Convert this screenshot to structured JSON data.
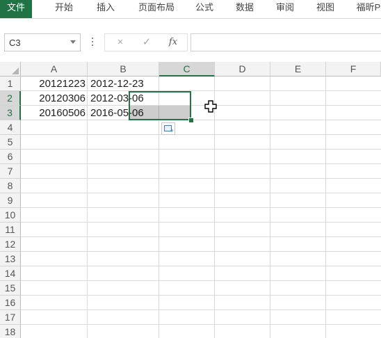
{
  "ribbon": {
    "tabs": [
      "文件",
      "开始",
      "插入",
      "页面布局",
      "公式",
      "数据",
      "审阅",
      "视图",
      "福昕P"
    ],
    "active_tab": "文件",
    "accent_color": "#217346"
  },
  "formula_bar": {
    "name_box": "C3",
    "cancel_icon": "×",
    "enter_icon": "✓",
    "fx_label": "fx",
    "formula": ""
  },
  "grid": {
    "columns": [
      "A",
      "B",
      "C",
      "D",
      "E",
      "F"
    ],
    "rows": [
      "1",
      "2",
      "3",
      "4",
      "5",
      "6",
      "7",
      "8",
      "9",
      "10",
      "11",
      "12",
      "13",
      "14",
      "15",
      "16",
      "17",
      "18"
    ],
    "selected_column": "C",
    "selected_rows": [
      "2",
      "3"
    ],
    "cells": [
      {
        "row": 1,
        "A": "20121223",
        "B": "2012-12-23"
      },
      {
        "row": 2,
        "A": "20120306",
        "B": "2012-03-06"
      },
      {
        "row": 3,
        "A": "20160506",
        "B": "2016-05-06"
      }
    ]
  }
}
